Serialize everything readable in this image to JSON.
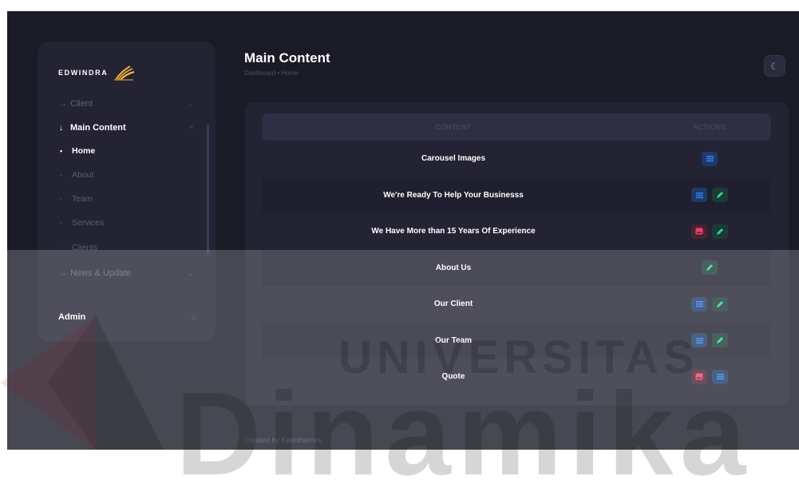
{
  "brand": {
    "name": "EDWINDRA"
  },
  "sidebar": {
    "items": [
      {
        "label": "Client",
        "icon": "arrow-right-icon"
      },
      {
        "label": "Main Content",
        "icon": "arrow-down-icon"
      },
      {
        "label": "News & Update",
        "icon": "arrow-right-icon"
      }
    ],
    "sub_items": [
      {
        "label": "Home"
      },
      {
        "label": "About"
      },
      {
        "label": "Team"
      },
      {
        "label": "Services"
      },
      {
        "label": "Clients"
      }
    ],
    "admin_label": "Admin"
  },
  "header": {
    "title": "Main Content",
    "breadcrumb": "Dashboard • Home"
  },
  "table": {
    "columns": [
      "CONTENT",
      "ACTIONS"
    ],
    "rows": [
      {
        "content": "Carousel Images",
        "actions": [
          "view"
        ]
      },
      {
        "content": "We're Ready To Help Your Businesss",
        "actions": [
          "view",
          "edit"
        ]
      },
      {
        "content": "We Have More than 15 Years Of Experience",
        "actions": [
          "image",
          "edit"
        ]
      },
      {
        "content": "About Us",
        "actions": [
          "edit"
        ]
      },
      {
        "content": "Our Client",
        "actions": [
          "view",
          "edit"
        ]
      },
      {
        "content": "Our Team",
        "actions": [
          "view",
          "edit"
        ]
      },
      {
        "content": "Quote",
        "actions": [
          "image",
          "view"
        ]
      }
    ]
  },
  "footer": {
    "text": "Created by Keenthemes"
  },
  "watermark": {
    "line1": "UNIVERSITAS",
    "line2": "Dinamika"
  },
  "colors": {
    "background": "#1b1b28",
    "card": "#232334",
    "accent_blue": "#1f6feb",
    "accent_green": "#32d296",
    "accent_red": "#f1416c",
    "logo_gold": "#e9b345"
  }
}
